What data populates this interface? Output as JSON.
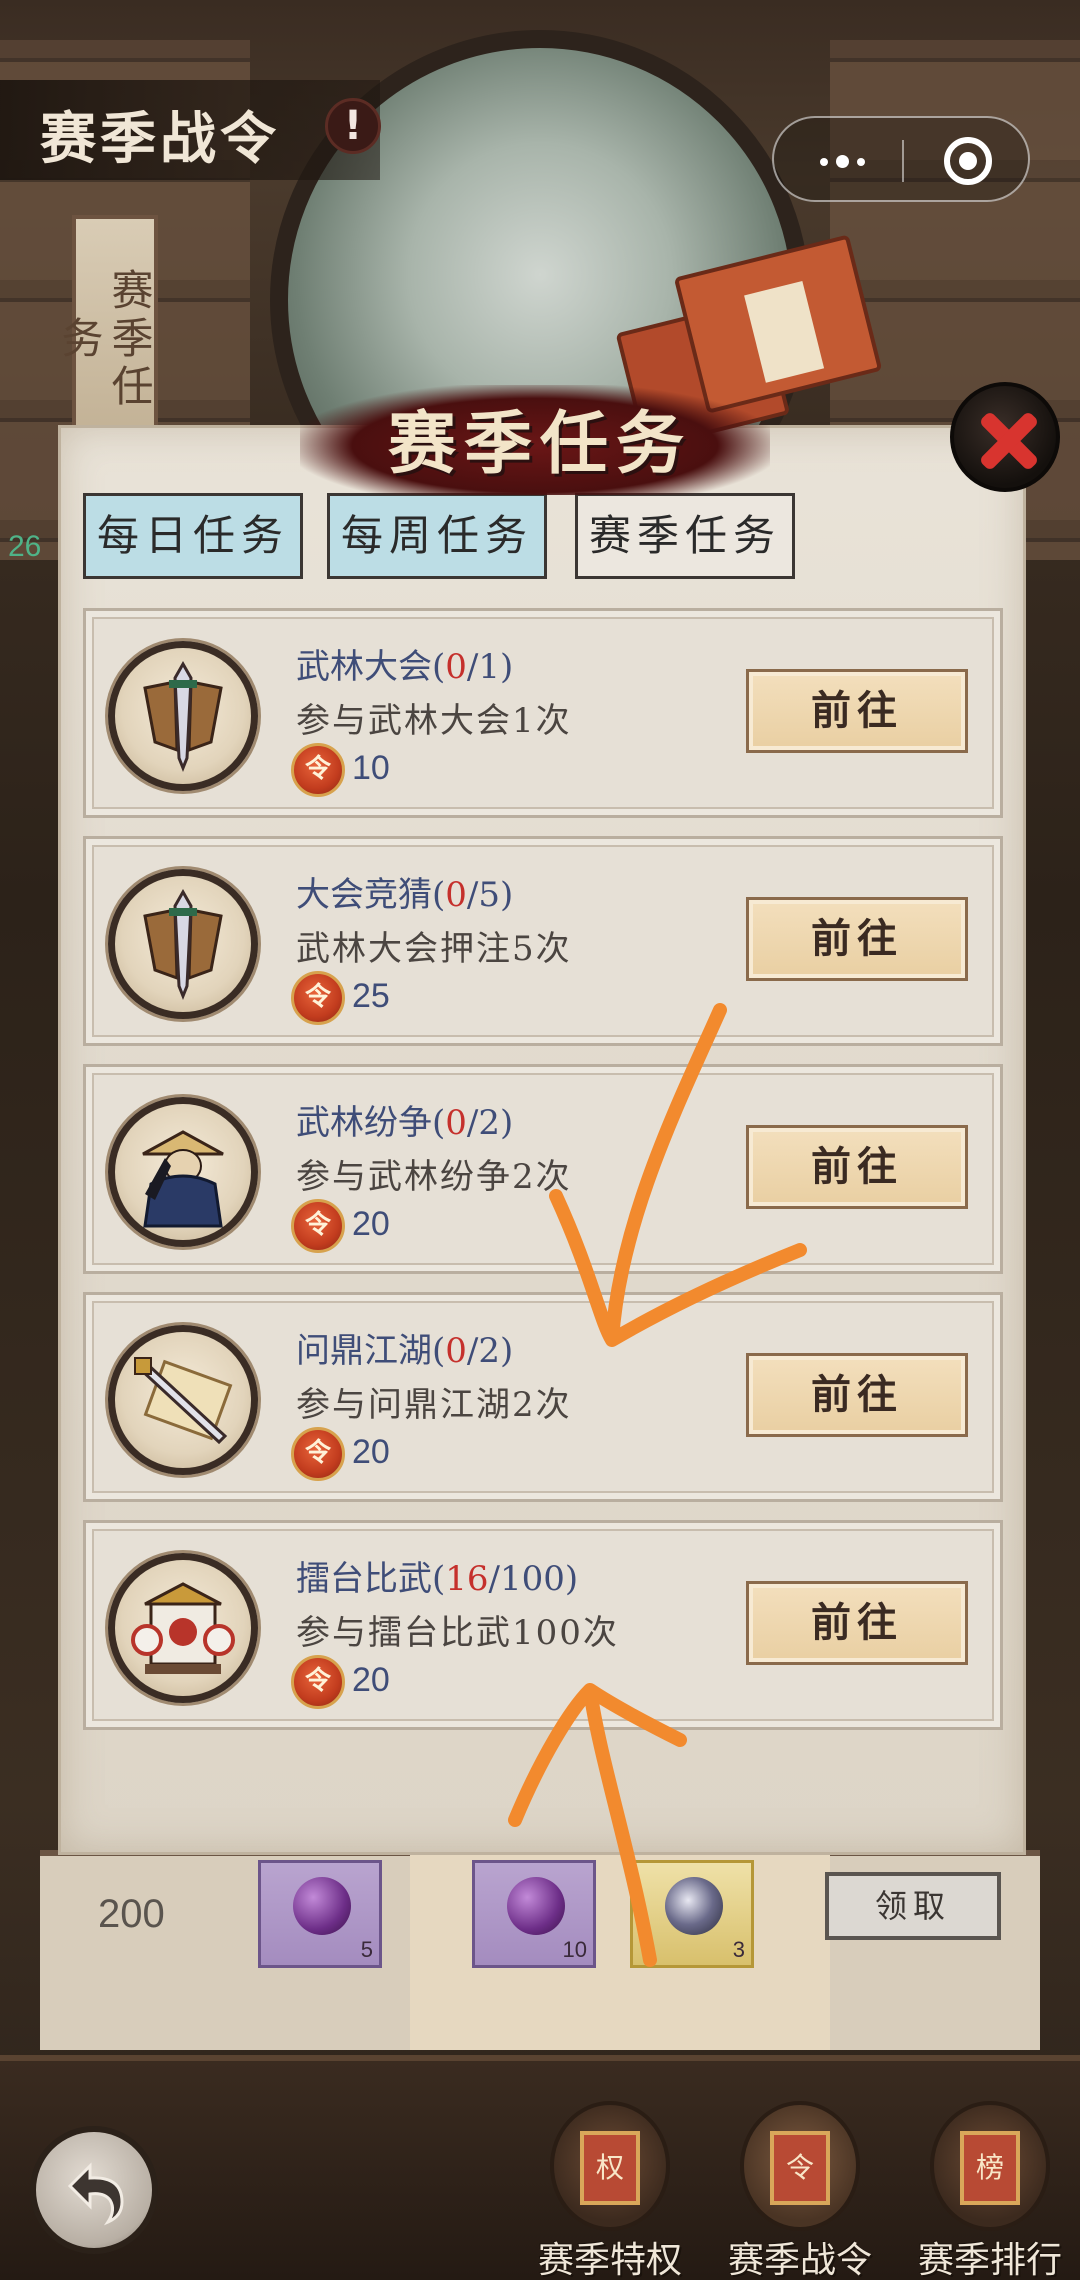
{
  "header": {
    "title": "赛季战令",
    "alert": "!"
  },
  "side_tag": {
    "label": "赛季任务",
    "counter": "26"
  },
  "panel": {
    "title": "赛季任务",
    "tabs": [
      {
        "label": "每日任务",
        "state": "active"
      },
      {
        "label": "每周任务",
        "state": "active"
      },
      {
        "label": "赛季任务",
        "state": "inactive"
      }
    ],
    "tasks": [
      {
        "name": "武林大会",
        "progress_current": "0",
        "progress_total": "1",
        "desc": "参与武林大会1次",
        "reward": "10",
        "button": "前往",
        "icon": "sword-shield-icon"
      },
      {
        "name": "大会竞猜",
        "progress_current": "0",
        "progress_total": "5",
        "desc": "武林大会押注5次",
        "reward": "25",
        "button": "前往",
        "icon": "sword-shield-icon"
      },
      {
        "name": "武林纷争",
        "progress_current": "0",
        "progress_total": "2",
        "desc": "参与武林纷争2次",
        "reward": "20",
        "button": "前往",
        "icon": "swordsman-hat-icon"
      },
      {
        "name": "问鼎江湖",
        "progress_current": "0",
        "progress_total": "2",
        "desc": "参与问鼎江湖2次",
        "reward": "20",
        "button": "前往",
        "icon": "sword-scroll-icon"
      },
      {
        "name": "擂台比武",
        "progress_current": "16",
        "progress_total": "100",
        "desc": "参与擂台比武100次",
        "reward": "20",
        "button": "前往",
        "icon": "arena-gate-icon"
      }
    ],
    "coin_glyph": "令"
  },
  "reward_strip": {
    "value": "200",
    "items": [
      {
        "count": "5",
        "icon": "purple-orb-icon"
      },
      {
        "count": "10",
        "icon": "purple-orb-icon"
      },
      {
        "count": "3",
        "icon": "yin-yang-orb-icon"
      }
    ],
    "claim_label": "领取"
  },
  "bottom_nav": {
    "items": [
      {
        "label": "赛季特权",
        "chip": "权"
      },
      {
        "label": "赛季战令",
        "chip": "令"
      },
      {
        "label": "赛季排行",
        "chip": "榜"
      }
    ]
  },
  "colors": {
    "accent_blue_text": "#3f4d78",
    "progress_red": "#c5302c",
    "annotation_orange": "#f28a2e",
    "tab_active": "#bcdde5"
  }
}
